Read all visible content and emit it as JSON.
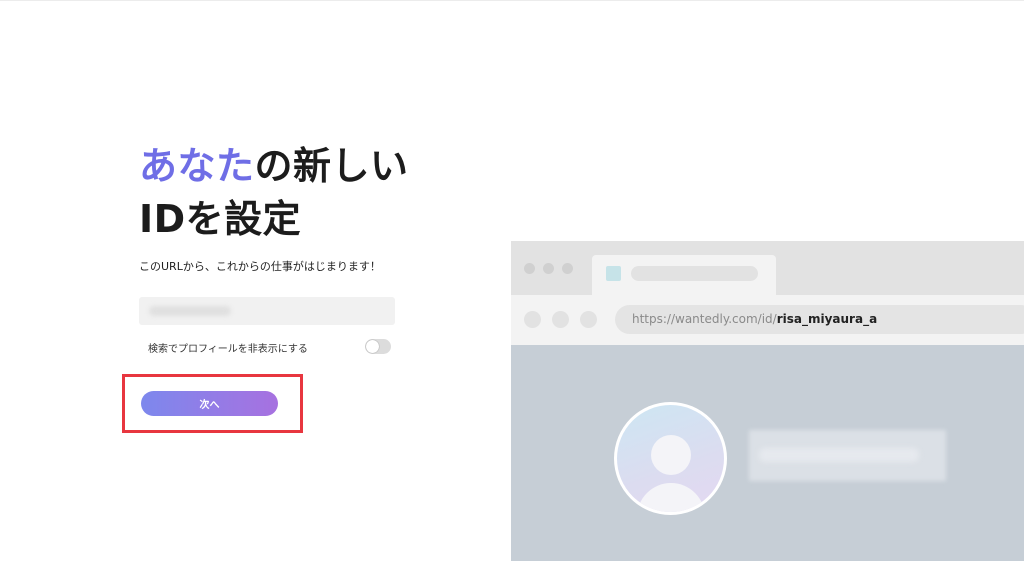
{
  "headline": {
    "accent": "あなた",
    "rest_line1": "の新しい",
    "line2": "IDを設定"
  },
  "subtitle": "このURLから、これからの仕事がはじまります！",
  "id_field": {
    "value": ""
  },
  "search_toggle": {
    "label": "検索でプロフィールを非表示にする",
    "enabled": false
  },
  "next_button": {
    "label": "次へ"
  },
  "preview": {
    "url_prefix": "https://wantedly.com/id/",
    "url_id": "risa_miyaura_a"
  },
  "colors": {
    "accent": "#6f6ee6",
    "button_gradient_start": "#7d88ed",
    "button_gradient_end": "#a771e0",
    "highlight": "#e8363f"
  }
}
